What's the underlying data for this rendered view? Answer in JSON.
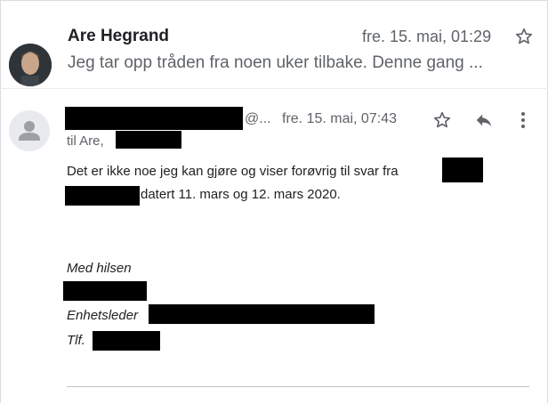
{
  "collapsed": {
    "sender": "Are Hegrand",
    "date": "fre. 15. mai, 01:29",
    "snippet": "Jeg tar opp tråden fra noen uker tilbake. Denne gang ..."
  },
  "expanded": {
    "sender_suffix": "@...",
    "date": "fre. 15. mai, 07:43",
    "to_prefix": "til Are,",
    "body_line1": "Det er ikke noe jeg kan gjøre og viser forøvrig til svar fra",
    "body_line2": "datert 11. mars og 12. mars 2020.",
    "closing": "Med hilsen",
    "title_label": "Enhetsleder",
    "phone_label": "Tlf."
  },
  "icons": {
    "star": "star-icon",
    "reply": "reply-icon",
    "more": "more-vert-icon",
    "avatar_placeholder": "person-icon"
  },
  "colors": {
    "text": "#202124",
    "secondary": "#5f6368",
    "redaction": "#000000"
  }
}
